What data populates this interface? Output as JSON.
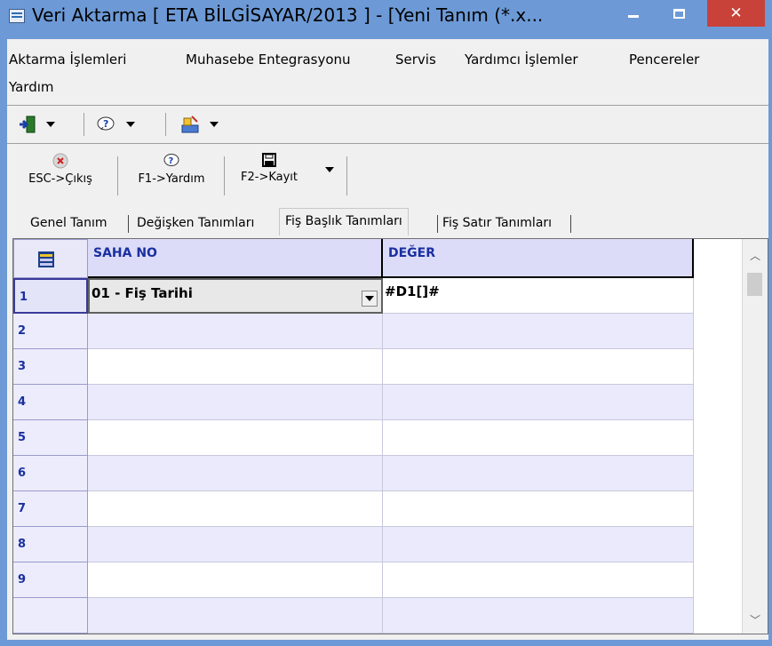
{
  "window": {
    "title": "Veri Aktarma [ ETA BİLGİSAYAR/2013 ]  - [Yeni Tanım (*.x..."
  },
  "menu": [
    "Aktarma İşlemleri",
    "Muhasebe Entegrasyonu",
    "Servis",
    "Yardımcı İşlemler",
    "Pencereler",
    "Yardım"
  ],
  "toolbar2": {
    "exit_label": "ESC->Çıkış",
    "help_label": "F1->Yardım",
    "save_label": "F2->Kayıt"
  },
  "tabs": [
    "Genel Tanım",
    "Değişken Tanımları",
    "Fiş Başlık Tanımları",
    "Fiş Satır Tanımları"
  ],
  "active_tab": "Fiş Başlık Tanımları",
  "grid": {
    "columns": [
      "SAHA NO",
      "DEĞER"
    ],
    "rows": [
      {
        "n": "1",
        "saha": "01 - Fiş Tarihi",
        "deger": "#D1[]#"
      },
      {
        "n": "2",
        "saha": "",
        "deger": ""
      },
      {
        "n": "3",
        "saha": "",
        "deger": ""
      },
      {
        "n": "4",
        "saha": "",
        "deger": ""
      },
      {
        "n": "5",
        "saha": "",
        "deger": ""
      },
      {
        "n": "6",
        "saha": "",
        "deger": ""
      },
      {
        "n": "7",
        "saha": "",
        "deger": ""
      },
      {
        "n": "8",
        "saha": "",
        "deger": ""
      },
      {
        "n": "9",
        "saha": "",
        "deger": ""
      }
    ]
  },
  "colors": {
    "frame": "#6d9ad6",
    "close": "#c8423a",
    "header_bg": "#dcdcf8",
    "alt_row": "#eaeafc",
    "header_text": "#1a2fa0"
  },
  "icons": [
    "app-icon",
    "exit-door-icon",
    "help-icon",
    "tools-icon",
    "close-circle-icon",
    "save-disk-icon",
    "dropdown-arrow-icon",
    "grid-corner-icon"
  ]
}
